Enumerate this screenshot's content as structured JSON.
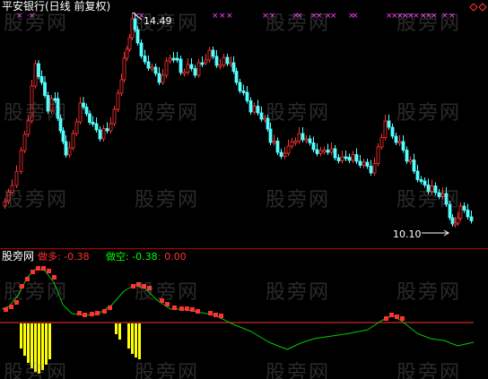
{
  "main_panel": {
    "title": "平安银行(日线 前复权)",
    "high_label": "14.49",
    "low_label": "10.10"
  },
  "indicator_panel": {
    "name": "股旁网",
    "long_label": "做多: -0.38",
    "short_label": "做空: -0.38",
    "value_label": ": 0.00"
  },
  "watermark_text": "股旁网",
  "colors": {
    "up": "#ff3232",
    "down": "#54ffff",
    "signal_line": "#00cc00",
    "bar": "#ffff00",
    "zero_line": "#ff3232",
    "marker": "#ff40ff"
  }
}
